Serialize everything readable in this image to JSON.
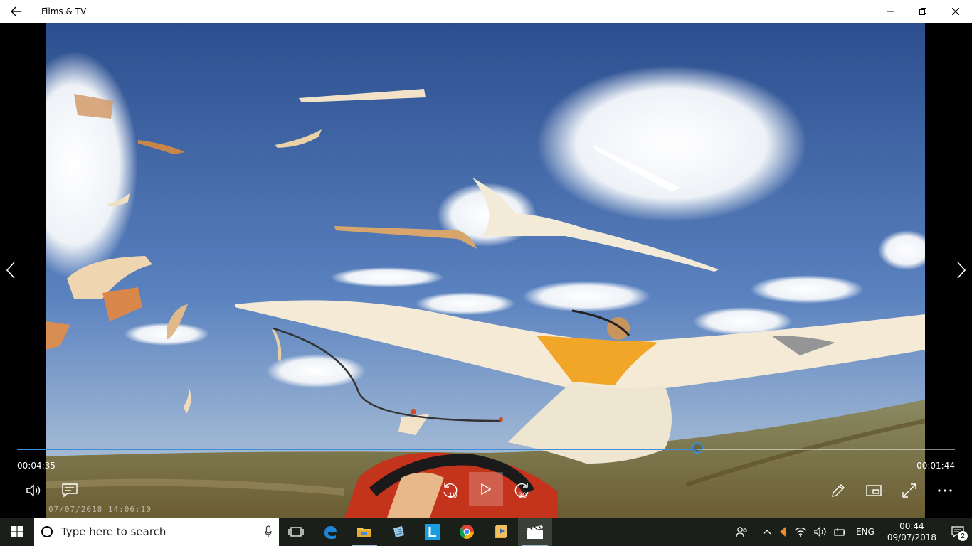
{
  "app": {
    "title": "Films & TV"
  },
  "colors": {
    "accent": "#3b8fd9",
    "titlebar": "#ffffff",
    "taskbar": "#1b1f1a"
  },
  "player": {
    "elapsed": "00:04:35",
    "remaining": "00:01:44",
    "progress_fraction": 0.725,
    "skip_back_label": "10",
    "skip_forward_label": "30",
    "video_timestamp": "07/07/2018 14:06:10"
  },
  "icons": {
    "back": "arrow-left-icon",
    "minimize": "minimize-icon",
    "maximize": "restore-icon",
    "close": "close-icon",
    "volume": "volume-icon",
    "captions": "captions-icon",
    "play": "play-icon",
    "edit": "pencil-icon",
    "miniview": "mini-view-icon",
    "fullscreen": "fullscreen-icon",
    "more": "more-icon"
  },
  "taskbar": {
    "search_placeholder": "Type here to search",
    "apps": [
      "task-view",
      "edge",
      "file-explorer",
      "notepad",
      "l-app",
      "chrome",
      "movie-maker",
      "films-and-tv"
    ],
    "language": "ENG",
    "time": "00:44",
    "date": "09/07/2018",
    "notification_count": "2"
  }
}
